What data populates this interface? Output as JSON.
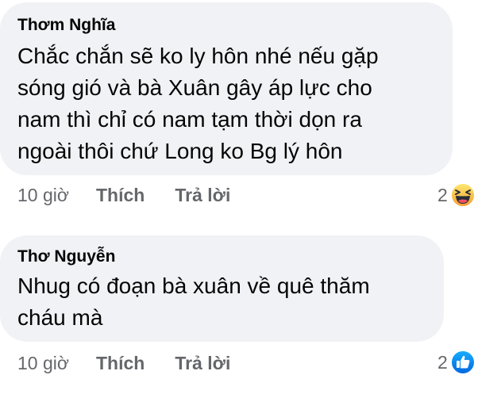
{
  "comments": [
    {
      "author": "Thơm Nghĩa",
      "text": "Chắc chắn sẽ ko ly hôn nhé nếu gặp\nsóng gió và bà Xuân gây áp lực cho\nnam thì chỉ có nam tạm thời dọn ra\nngoài thôi chứ Long ko Bg lý hôn",
      "time": "10 giờ",
      "like_label": "Thích",
      "reply_label": "Trả lời",
      "reaction_count": "2",
      "reaction_icon": "haha-icon"
    },
    {
      "author": "Thơ Nguyễn",
      "text": "Nhug có đoạn bà xuân về quê thăm\ncháu mà",
      "time": "10 giờ",
      "like_label": "Thích",
      "reply_label": "Trả lời",
      "reaction_count": "2",
      "reaction_icon": "like-icon"
    }
  ],
  "colors": {
    "bubble": "#f0f2f5",
    "text": "#050505",
    "meta": "#65676b",
    "like_blue": "#1877f2",
    "haha_yellow": "#f7b125"
  }
}
